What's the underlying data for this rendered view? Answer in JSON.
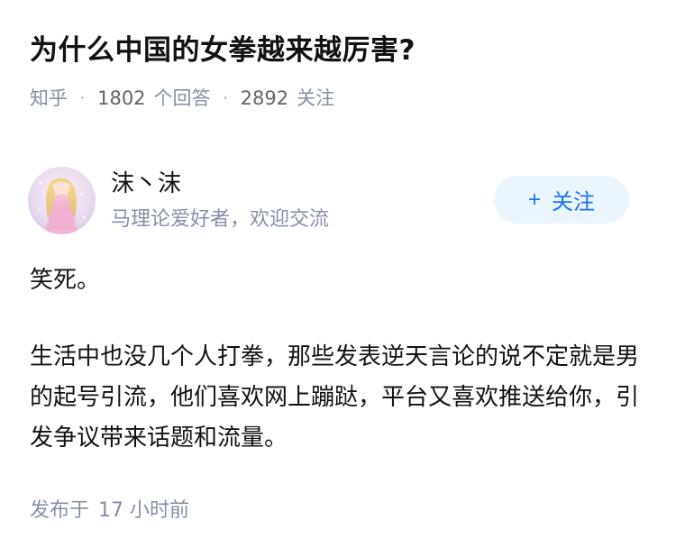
{
  "question": {
    "title": "为什么中国的女拳越来越厉害?",
    "source": "知乎",
    "answer_count": "1802",
    "answer_label": "个回答",
    "follower_count": "2892",
    "follower_label": "关注"
  },
  "author": {
    "name": "沫丶沫",
    "bio": "马理论爱好者，欢迎交流",
    "avatar_icon": "avatar-illustration",
    "follow_label": "关注",
    "follow_icon": "plus-icon"
  },
  "answer": {
    "paragraphs": [
      "笑死。",
      "生活中也没几个人打拳，那些发表逆天言论的说不定就是男的起号引流，他们喜欢网上蹦跶，平台又喜欢推送给你，引发争议带来话题和流量。"
    ]
  },
  "footer": {
    "published_label": "发布于",
    "published_time": "17 小时前"
  },
  "colors": {
    "title": "#121212",
    "meta": "#8590a6",
    "accent": "#1772f6",
    "follow_bg": "#ebf5fd"
  }
}
